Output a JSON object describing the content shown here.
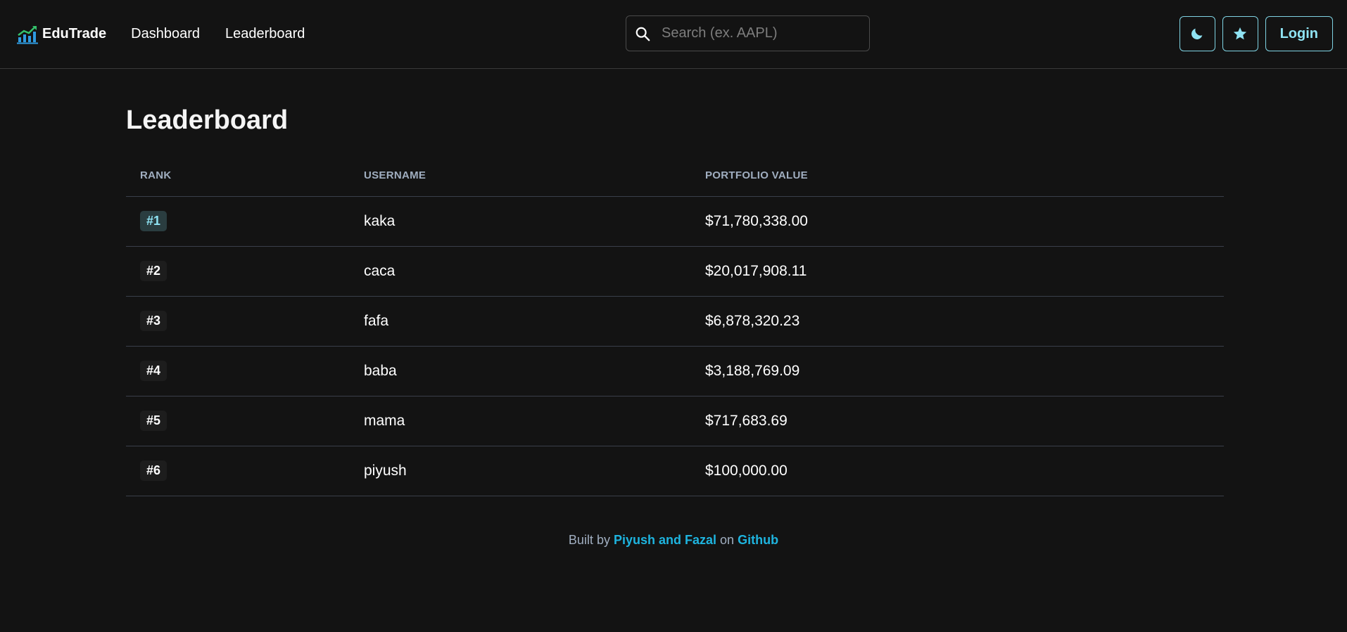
{
  "nav": {
    "brand": "EduTrade",
    "links": [
      "Dashboard",
      "Leaderboard"
    ],
    "search_placeholder": "Search (ex. AAPL)",
    "login_label": "Login",
    "accent": "#8fe3f3"
  },
  "main": {
    "title": "Leaderboard",
    "columns": [
      "RANK",
      "USERNAME",
      "PORTFOLIO VALUE"
    ],
    "rows": [
      {
        "rank": "#1",
        "username": "kaka",
        "value": "$71,780,338.00"
      },
      {
        "rank": "#2",
        "username": "caca",
        "value": "$20,017,908.11"
      },
      {
        "rank": "#3",
        "username": "fafa",
        "value": "$6,878,320.23"
      },
      {
        "rank": "#4",
        "username": "baba",
        "value": "$3,188,769.09"
      },
      {
        "rank": "#5",
        "username": "mama",
        "value": "$717,683.69"
      },
      {
        "rank": "#6",
        "username": "piyush",
        "value": "$100,000.00"
      }
    ]
  },
  "footer": {
    "prefix": "Built by",
    "authors": "Piyush and Fazal",
    "middle": "on",
    "link": "Github"
  }
}
